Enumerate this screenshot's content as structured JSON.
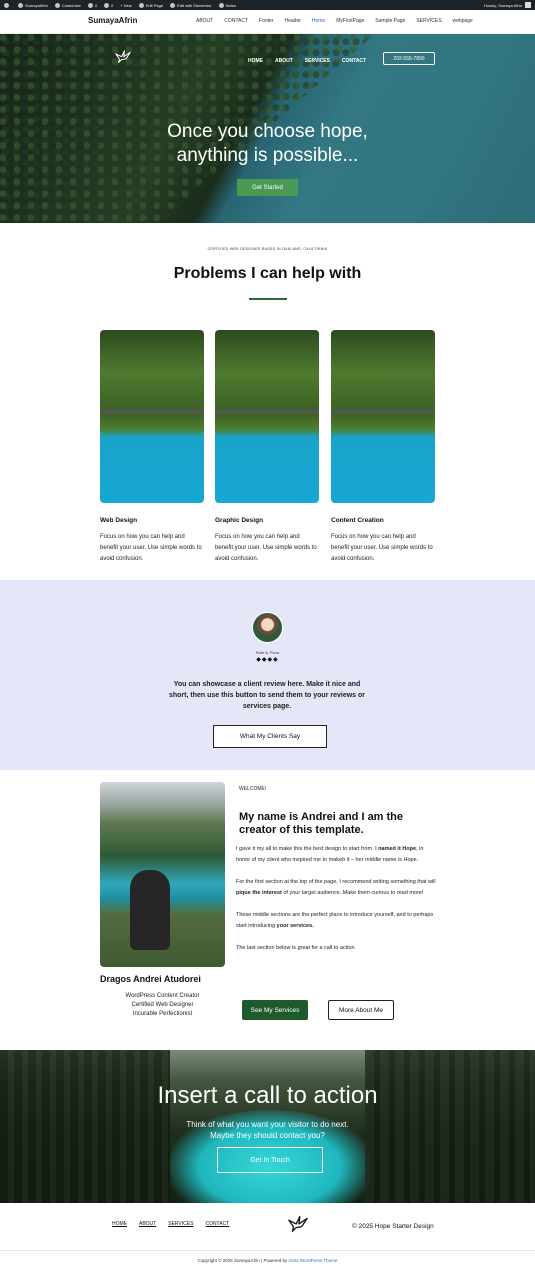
{
  "adminbar": {
    "items": [
      "SumayaAfrin",
      "Customize",
      "0",
      "0",
      "+ New",
      "Edit Page",
      "Edit with Elementor",
      "Notes"
    ],
    "howdy": "Howdy, Sumaya Afrin"
  },
  "header": {
    "site_title": "SumayaAfrin",
    "menu": [
      "ABOUT",
      "CONTACT",
      "Footer",
      "Header",
      "Home",
      "MyFirstPage",
      "Sample Page",
      "SERVICES",
      "webpage"
    ],
    "active_index": 4
  },
  "hero": {
    "nav": [
      "HOME",
      "ABOUT",
      "SERVICES",
      "CONTACT"
    ],
    "phone": "202-555-7890",
    "title_line1": "Once you choose hope,",
    "title_line2": "anything is possible...",
    "button": "Get Started"
  },
  "problems": {
    "kicker": "CERTIFIED WEB DESIGNER BASED IN OAKLAND, CALIFORNIA",
    "title": "Problems I can help with",
    "cards": [
      {
        "label": "Web Design",
        "desc": "Focus on how you can help and benefit your user. Use simple words to avoid confusion."
      },
      {
        "label": "Graphic Design",
        "desc": "Focus on how you can help and benefit your user. Use simple words to avoid confusion."
      },
      {
        "label": "Content Creation",
        "desc": "Focus on how you can help and benefit your user. Use simple words to avoid confusion."
      }
    ]
  },
  "testimonial": {
    "name": "Ruth A. Flora",
    "stars": "◆◆◆◆",
    "quote": "You can showcase a client review here. Make it nice and short, then use this button to send them to your reviews or services page.",
    "button": "What My Clients Say"
  },
  "about": {
    "welcome": "WELCOME!",
    "heading": "My name is Andrei and I am the creator of this template.",
    "p1_a": "I gave it my all to make this the best design to start from. I ",
    "p1_b": "named it Hope",
    "p1_c": ", in honor of my client who inspired me to makeb it – her middle name is Hope.",
    "p2_a": "For the first section at the top of the page, I recommend writing something that will ",
    "p2_b": "pique the interest",
    "p2_c": " of your target audience. Make them curious to read more!",
    "p3_a": "These middle sections are the perfect place to introduce yourself, and to perhaps start introducing ",
    "p3_b": "your services.",
    "p4": "The last section below is great for a call to action",
    "name": "Dragos Andrei Atudorei",
    "roles": [
      "WordPress Content Creator",
      "Certified Web Designer",
      "Incurable Perfectionist"
    ],
    "btn_services": "See My Services",
    "btn_more": "More About Me"
  },
  "cta": {
    "title": "Insert a call to action",
    "sub1": "Think of what you want your visitor to do next.",
    "sub2": "Maybe they should contact you?",
    "button": "Get In Touch"
  },
  "footer": {
    "nav": [
      "HOME",
      "ABOUT",
      "SERVICES",
      "CONTACT"
    ],
    "copy": "© 2025 Hope Starter Design",
    "bottom_prefix": "Copyright © 2025 SumayaAfrin | Powered by ",
    "bottom_link": "Astra WordPress Theme"
  }
}
